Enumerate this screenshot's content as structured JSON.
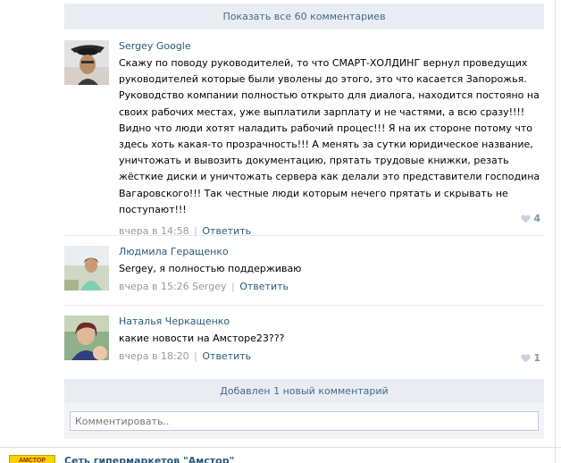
{
  "show_all": {
    "label": "Показать все 60 комментариев"
  },
  "comments": [
    {
      "author": "Sergey Google",
      "text": "Скажу по поводу руководителей, то что СМАРТ-ХОЛДИНГ вернул проведущих руководителей которые были уволены до этого, это что касается Запорожья. Руководство компании полностью открыто для диалога, находится постояно на своих рабочих местах, уже выплатили зарплату и не частями, а всю сразу!!!! Видно что люди хотят наладить рабочий процес!!! Я на их стороне потому что здесь хоть какая-то прозрачность!!! А менять за сутки юридическое название, уничтожать и вывозить документацию, прятать трудовые книжки, резать жёсткие диски и уничтожать сервера как делали это представители господина Вагаровского!!! Так честные люди которым нечего прятать и скрывать не поступают!!!",
      "time": "вчера в 14:58",
      "reply_label": "Ответить",
      "likes": "4"
    },
    {
      "author": "Людмила Геращенко",
      "text": "Sergey, я полностью поддерживаю",
      "time": "вчера в 15:26",
      "addressee": "Sergey",
      "reply_label": "Ответить",
      "likes": ""
    },
    {
      "author": "Наталья Черкащенко",
      "text": "какие новости на Амсторе23???",
      "time": "вчера в 18:20",
      "reply_label": "Ответить",
      "likes": "1"
    }
  ],
  "added_notice": "Добавлен 1 новый комментарий",
  "composer": {
    "placeholder": "Комментировать.."
  },
  "next_post": {
    "logo_text": "АМСТОР",
    "title": "Сеть гипермаркетов \"Амстор\""
  },
  "icons": {
    "like": "heart-icon"
  }
}
